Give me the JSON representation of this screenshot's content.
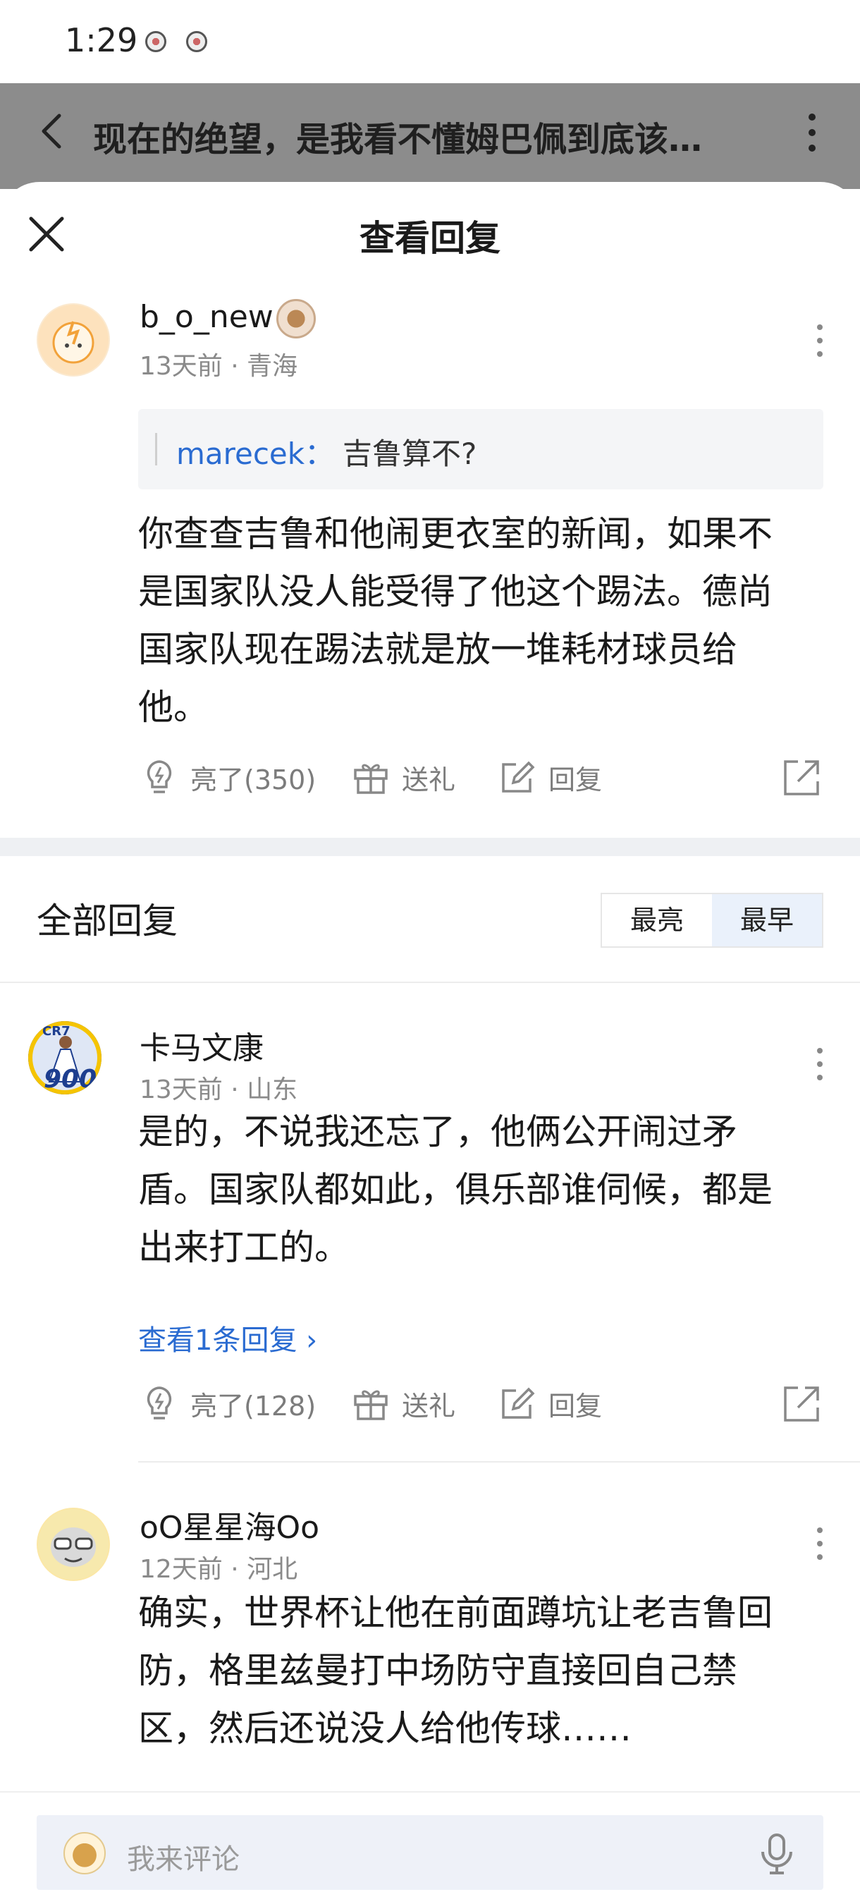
{
  "status_bar": {
    "time": "1:29"
  },
  "thread": {
    "title": "现在的绝望，是我看不懂姆巴佩到底该…"
  },
  "sheet": {
    "title": "查看回复"
  },
  "main_comment": {
    "user": "b_o_new",
    "meta": "13天前 · 青海",
    "quote_author": "marecek：",
    "quote_text": "吉鲁算不?",
    "body_lines": [
      "你查查吉鲁和他闹更衣室的新闻，如果不",
      "是国家队没人能受得了他这个踢法。德尚",
      "国家队现在踢法就是放一堆耗材球员给",
      "他。"
    ],
    "like_label": "亮了(350)",
    "gift_label": "送礼",
    "reply_label": "回复"
  },
  "replies_section": {
    "title": "全部回复",
    "sort_options": [
      "最亮",
      "最早"
    ],
    "active_sort": "最早"
  },
  "replies": [
    {
      "user": "卡马文康",
      "meta": "13天前 · 山东",
      "body_lines": [
        "是的，不说我还忘了，他俩公开闹过矛",
        "盾。国家队都如此，俱乐部谁伺候，都是",
        "出来打工的。"
      ],
      "view_replies": "查看1条回复 ›",
      "like_label": "亮了(128)",
      "gift_label": "送礼",
      "reply_label": "回复",
      "avatar_text": "900",
      "avatar_tag": "CR7"
    },
    {
      "user": "oO星星海Oo",
      "meta": "12天前 · 河北",
      "body_lines": [
        "确实，世界杯让他在前面蹲坑让老吉鲁回",
        "防，格里兹曼打中场防守直接回自己禁",
        "区，然后还说没人给他传球……"
      ]
    }
  ],
  "bottom_bar": {
    "placeholder": "我来评论"
  },
  "colors": {
    "link": "#2a6bd1",
    "muted": "#8a8a8a",
    "overlay": "#8c8c8c"
  }
}
